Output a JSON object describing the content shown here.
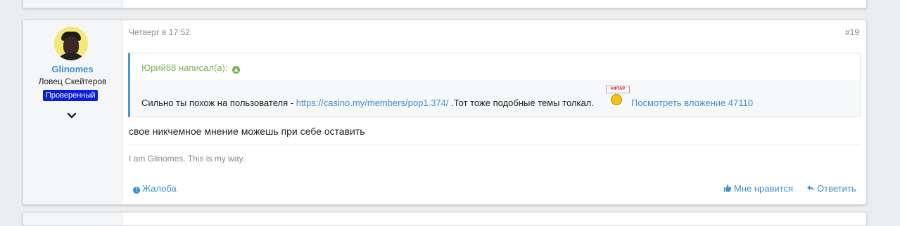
{
  "post": {
    "author": {
      "name": "Glinomes",
      "title": "Ловец Скейтеров",
      "badge": "Проверенный",
      "avatar_icon": "avatar-image",
      "expand_icon": "chevron-down-icon"
    },
    "date": "Четверг в 17:52",
    "number": "#19",
    "quote": {
      "header": "Юрий88 написал(а):",
      "header_icon": "arrow-up-circle-icon",
      "text_before": "Сильно ты похож на пользователя - ",
      "link": "https://casino.my/members/pop1.374/",
      "text_after": " .Тот тоже подобные темы толкал.",
      "smiley_sign": "АФТАР",
      "attachment_link": "Посмотреть вложение 47110"
    },
    "message": "свое никчемное мнение можешь при себе оставить",
    "signature": "I am Glinomes. This is my way.",
    "actions": {
      "report": "Жалоба",
      "like": "Мне нравится",
      "reply": "Ответить"
    }
  },
  "colors": {
    "link": "#3c8fd6",
    "quote_header": "#7bb35c",
    "badge_bg": "#0b1de0",
    "page_bg": "#ebedef"
  }
}
